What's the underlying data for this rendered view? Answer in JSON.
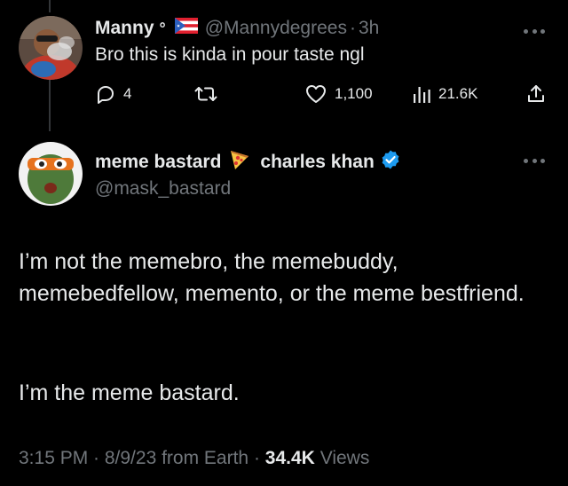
{
  "reply": {
    "display_name": "Manny",
    "name_suffix": "°",
    "handle": "@Mannydegrees",
    "separator": "·",
    "time": "3h",
    "text": "Bro this is kinda in pour taste ngl",
    "flag_icon": "puerto-rico-flag-icon",
    "actions": {
      "replies": "4",
      "retweets": "",
      "likes": "1,100",
      "views": "21.6K"
    }
  },
  "tweet": {
    "display_name": "meme bastard",
    "second_name": "charles khan",
    "handle": "@mask_bastard",
    "verified": true,
    "accent_color": "#1d9bf0",
    "paragraph_1": "I’m not the memebro, the memebuddy, memebedfellow, memento, or the meme bestfriend.",
    "paragraph_2": "I’m the meme bastard.",
    "timestamp": "3:15 PM · 8/9/23 from Earth ·",
    "views_count": "34.4K",
    "views_label": "Views"
  },
  "icons": {
    "reply": "speech-bubble-icon",
    "retweet": "retweet-icon",
    "like": "heart-icon",
    "views": "bar-chart-icon",
    "share": "share-icon",
    "more": "more-dots-icon",
    "pizza": "pizza-emoji-icon",
    "verified": "verified-badge-icon"
  }
}
